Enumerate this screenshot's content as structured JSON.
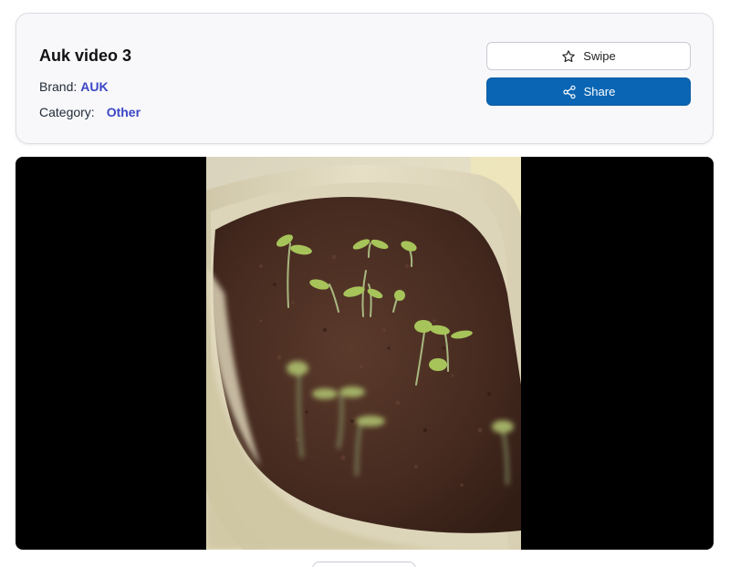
{
  "video": {
    "title": "Auk video 3",
    "brand_label": "Brand:",
    "brand_value": "AUK",
    "category_label": "Category:",
    "category_value": "Other"
  },
  "actions": {
    "swipe_label": "Swipe",
    "swipe_icon": "star-icon",
    "share_label": "Share",
    "share_icon": "share-icon"
  },
  "player": {
    "description_icon": "video-frame"
  },
  "colors": {
    "accent_link": "#3b46c4",
    "share_button": "#0a66b4",
    "card_background": "#f8f8fb",
    "player_background": "#000000"
  }
}
